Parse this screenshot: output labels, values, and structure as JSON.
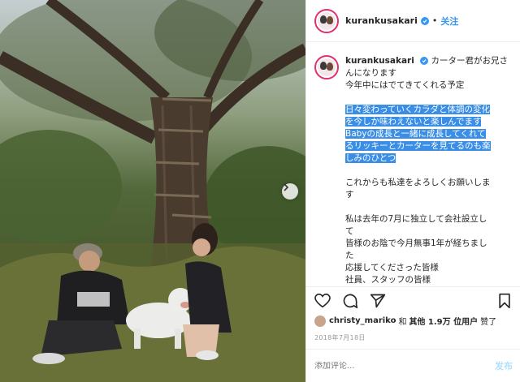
{
  "post": {
    "username": "kurankusakari",
    "follow_label": "关注",
    "header_sep": "•",
    "caption_lines": [
      "カーター君がお兄さ",
      "んになります",
      "今年中にはでてきてくれる予定"
    ],
    "highlighted_lines": [
      "日々変わっていくカラダと体調の変化",
      "を今しか味わえないと楽しんでます",
      "Babyの成長と一緒に成長してくれて",
      "るリッキーとカーターを見てるのも楽",
      "しみのひとつ"
    ],
    "paragraph2": [
      "これからも私達をよろしくお願いしま",
      "す"
    ],
    "paragraph3": [
      "私は去年の7月に独立して会社設立し",
      "て",
      "皆様のお陰で今月無事1年が経ちまし",
      "た",
      "応援してくださった皆様",
      "社員、スタッフの皆様"
    ],
    "likes": {
      "liker": "christy_mariko",
      "and": "和",
      "others": "其他 1.9万 位用户",
      "liked": "赞了"
    },
    "date": "2018年7月18日",
    "comment_placeholder": "添加评论...",
    "post_label": "发布"
  },
  "colors": {
    "accent": "#3897f0",
    "highlight": "#3a8ee6",
    "post_disabled": "#b2dffc"
  },
  "icons": [
    "verified-badge-icon",
    "chevron-right-icon",
    "heart-icon",
    "comment-icon",
    "share-icon",
    "bookmark-icon"
  ]
}
